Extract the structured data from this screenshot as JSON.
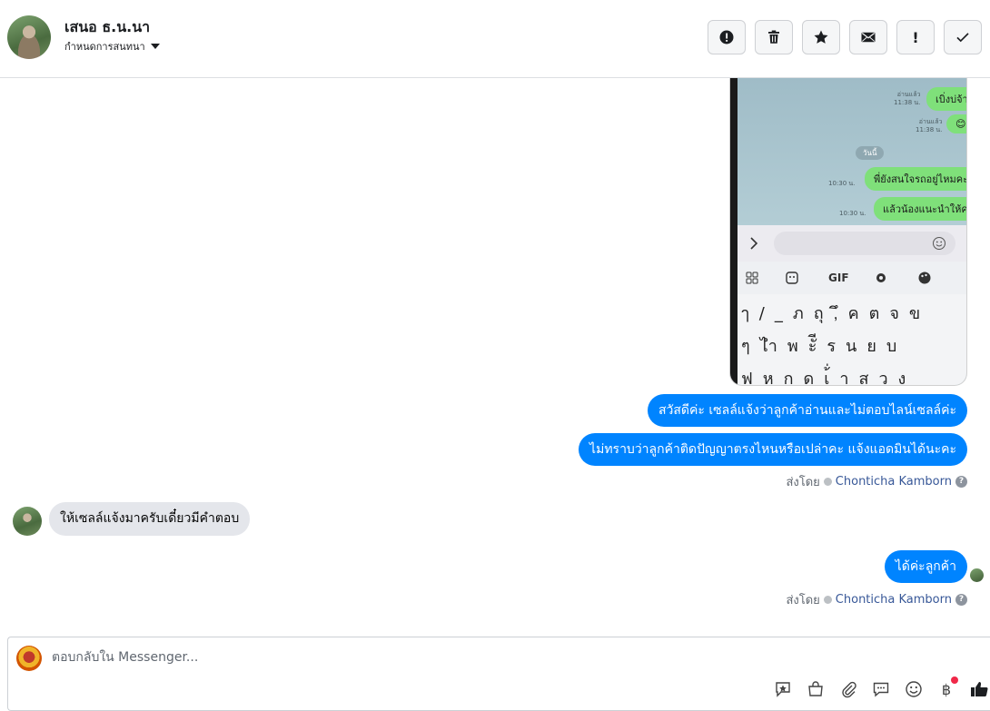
{
  "header": {
    "contact_name": "เสนอ ธ.น.นา",
    "assign_label": "กำหนดการสนทนา",
    "actions": [
      {
        "name": "report-spam-button",
        "icon": "alert-circle-icon"
      },
      {
        "name": "delete-button",
        "icon": "trash-icon"
      },
      {
        "name": "star-button",
        "icon": "star-icon"
      },
      {
        "name": "mark-unread-button",
        "icon": "envelope-icon"
      },
      {
        "name": "follow-up-button",
        "icon": "exclamation-icon",
        "glyph": "!"
      },
      {
        "name": "mark-done-button",
        "icon": "checkmark-icon"
      }
    ]
  },
  "screenshot": {
    "messages": [
      {
        "text": "เบิ่งบ่จ้า",
        "time": "อ่านแล้ว\n11:38 น."
      },
      {
        "text": "😊",
        "time": "อ่านแล้ว\n11:38 น."
      },
      {
        "text": "พี่ยังสนใจรถอยู่ไหมคะ",
        "time": "10:30 น."
      },
      {
        "text": "แล้วน้องแนะนำให้คะ",
        "time": "10:30 น."
      }
    ],
    "today_label": "วันนี้",
    "gif_label": "GIF",
    "key_row1": "ๅ/_ภถุ,ึคตจข",
    "key_row2": "ๆไำพะัีรนยบ",
    "key_row3": "ฟหกดเ้่าสวง"
  },
  "conversation": {
    "outgoing_1": "สวัสดีค่ะ เซลล์แจ้งว่าลูกค้าอ่านและไม่ตอบไลน์เซลล์ค่ะ",
    "outgoing_2": "ไม่ทราบว่าลูกค้าติดปัญญาตรงไหนหรือเปล่าคะ แจ้งแอดมินได้นะคะ",
    "sent_by_label": "ส่งโดย",
    "agent_name": "Chonticha Kamborn",
    "incoming_1": "ให้เซลล์แจ้งมาครับเดี๋ยวมีคำตอบ",
    "outgoing_3": "ได้ค่ะลูกค้า"
  },
  "composer": {
    "placeholder": "ตอบกลับใน Messenger...",
    "tools": [
      "saved-reply-icon",
      "shop-bag-icon",
      "attachment-icon",
      "chat-bubble-icon",
      "emoji-icon",
      "baht-icon",
      "thumbs-up-icon"
    ],
    "baht_glyph": "฿"
  },
  "colors": {
    "outgoing_bubble": "#0084ff",
    "incoming_bubble": "#e4e6eb",
    "line_bubble": "#7fe07a",
    "notification_dot": "#f02849"
  }
}
